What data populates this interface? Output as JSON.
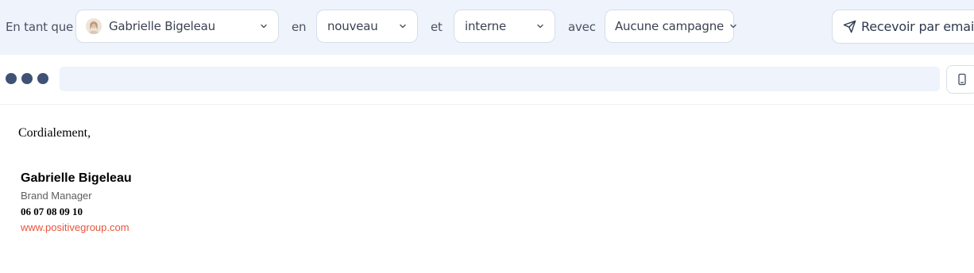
{
  "toolbar": {
    "as_label": "En tant que",
    "user_select": "Gabrielle Bigeleau",
    "in_label": "en",
    "state_select": "nouveau",
    "and_label": "et",
    "type_select": "interne",
    "with_label": "avec",
    "campaign_select": "Aucune campagne",
    "send_button": "Recevoir par email"
  },
  "email": {
    "closing": "Cordialement,",
    "signature": {
      "name": "Gabrielle Bigeleau",
      "title": "Brand Manager",
      "phone": "06 07 08 09 10",
      "website": "www.positivegroup.com"
    }
  },
  "colors": {
    "toolbar_bg": "#eef3fc",
    "dots": "#3f5275",
    "link": "#e8533a"
  }
}
